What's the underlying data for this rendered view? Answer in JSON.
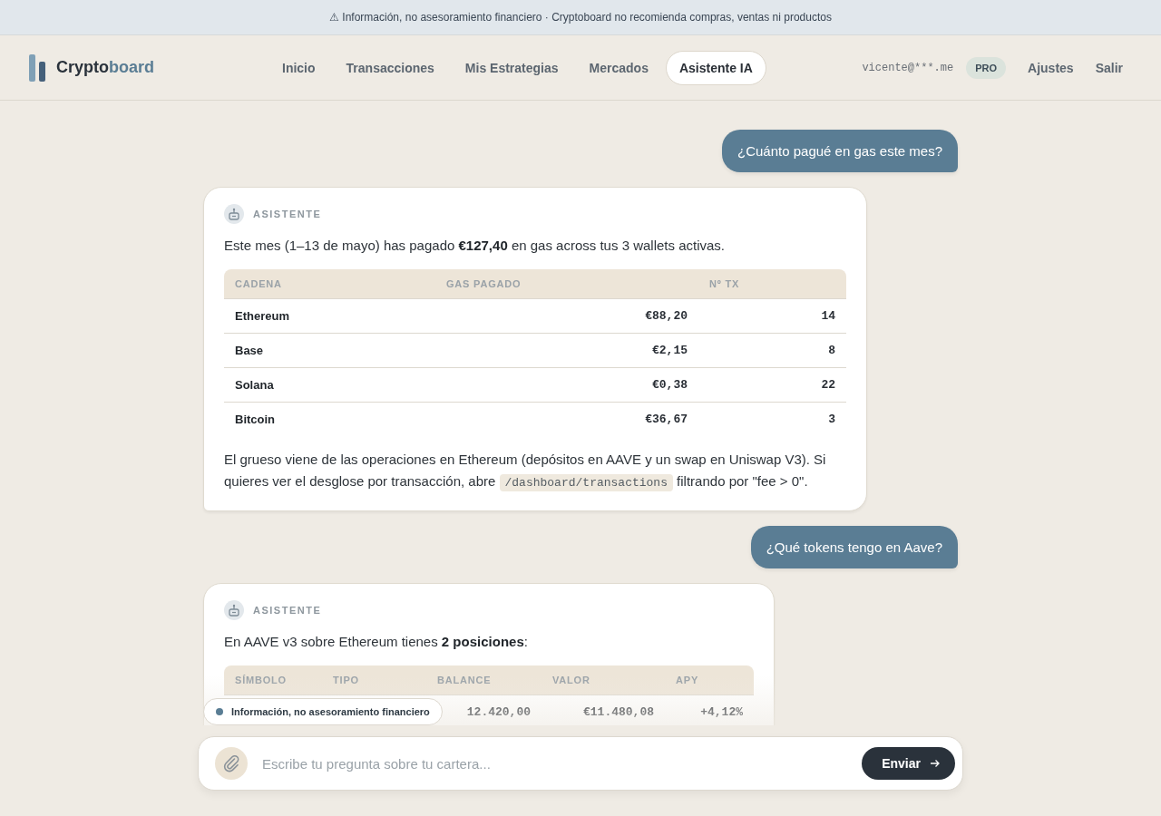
{
  "banner": {
    "text": "⚠ Información, no asesoramiento financiero · Cryptoboard no recomienda compras, ventas ni productos"
  },
  "brand": {
    "name_start": "Crypto",
    "name_end": "board"
  },
  "nav": [
    {
      "label": "Inicio",
      "selected": false
    },
    {
      "label": "Transacciones",
      "selected": false
    },
    {
      "label": "Mis Estrategias",
      "selected": false
    },
    {
      "label": "Mercados",
      "selected": false
    },
    {
      "label": "Asistente IA",
      "selected": true
    }
  ],
  "account": {
    "email": "vicente@***.me",
    "plan": "PRO",
    "links": [
      "Ajustes",
      "Salir"
    ]
  },
  "messages": [
    {
      "kind": "user",
      "text": "¿Cuánto pagué en gas este mes?"
    },
    {
      "kind": "assistant",
      "author": "ASISTENTE",
      "blocks": [
        {
          "kind": "paragraph",
          "segments": [
            {
              "kind": "text",
              "text": "Este mes (1–13 de mayo) has pagado **€127,40** en gas across tus 3 wallets activas."
            }
          ]
        },
        {
          "kind": "table",
          "columns": [
            "CADENA",
            "GAS PAGADO",
            "Nº TX"
          ],
          "rows": [
            [
              "Ethereum",
              "€88,20",
              "14"
            ],
            [
              "Base",
              "€2,15",
              "8"
            ],
            [
              "Solana",
              "€0,38",
              "22"
            ],
            [
              "Bitcoin",
              "€36,67",
              "3"
            ]
          ]
        },
        {
          "kind": "paragraph",
          "segments": [
            {
              "kind": "text",
              "text": "El grueso viene de las operaciones en Ethereum (depósitos en AAVE y un swap en Uniswap V3). Si quieres ver el desglose por transacción, abre "
            },
            {
              "kind": "code",
              "text": "/dashboard/transactions"
            },
            {
              "kind": "text",
              "text": " filtrando por \"fee > 0\"."
            }
          ]
        }
      ]
    },
    {
      "kind": "user",
      "text": "¿Qué tokens tengo en Aave?"
    },
    {
      "kind": "assistant",
      "author": "ASISTENTE",
      "blocks": [
        {
          "kind": "paragraph",
          "segments": [
            {
              "kind": "text",
              "text": "En AAVE v3 sobre Ethereum tienes **2 posiciones**:"
            }
          ]
        },
        {
          "kind": "table",
          "columns": [
            "SÍMBOLO",
            "TIPO",
            "BALANCE",
            "VALOR",
            "APY"
          ],
          "rows": [
            [
              null,
              null,
              "12.420,00",
              "€11.480,08",
              "+4,12%"
            ]
          ]
        }
      ]
    }
  ],
  "disclaimer_pill": {
    "text": "Información, no asesoramiento financiero"
  },
  "composer": {
    "placeholder": "Escribe tu pregunta sobre tu cartera...",
    "button": "Enviar"
  }
}
